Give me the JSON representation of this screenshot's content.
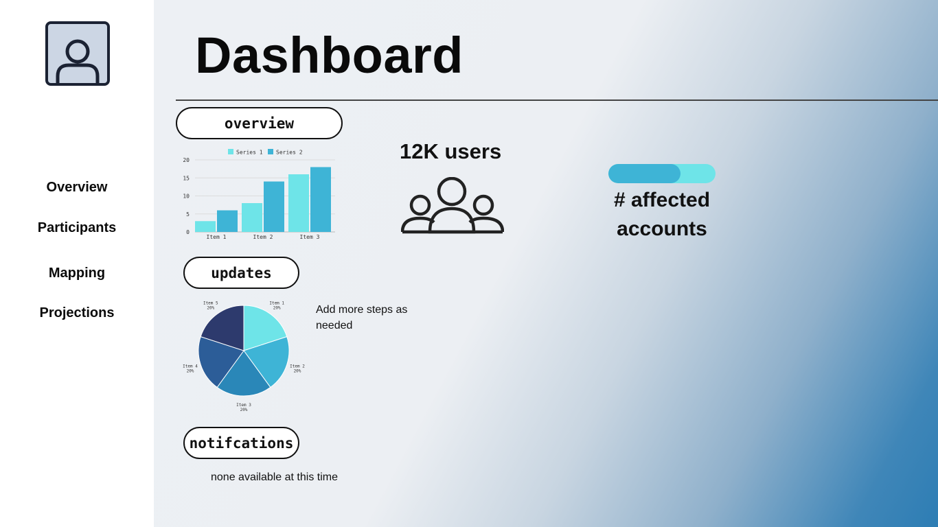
{
  "page": {
    "title": "Dashboard"
  },
  "sidebar": {
    "avatar_icon": "user-icon",
    "items": [
      {
        "label": "Overview"
      },
      {
        "label": "Participants"
      },
      {
        "label": "Mapping"
      },
      {
        "label": "Projections"
      }
    ]
  },
  "sections": {
    "overview": "overview",
    "updates": "updates",
    "notifications": "notifcations"
  },
  "stats": {
    "users": "12K users",
    "users_icon": "group-icon",
    "affected_label": "# affected accounts",
    "affected_progress": 0.67
  },
  "updates_note": "Add more steps as needed",
  "notifications_text": "none available at this time",
  "colors": {
    "series1": "#6ee4e8",
    "series2": "#3eb4d6",
    "pie": [
      "#6ee4e8",
      "#3eb4d6",
      "#2a87b8",
      "#2c5d98",
      "#2d3a6d"
    ]
  },
  "chart_data": [
    {
      "type": "bar",
      "categories": [
        "Item 1",
        "Item 2",
        "Item 3"
      ],
      "series": [
        {
          "name": "Series 1",
          "values": [
            3,
            8,
            16
          ]
        },
        {
          "name": "Series 2",
          "values": [
            6,
            14,
            18
          ]
        }
      ],
      "ylim": [
        0,
        20
      ],
      "yticks": [
        0,
        5,
        10,
        15,
        20
      ],
      "grid": true,
      "legend": "top"
    },
    {
      "type": "pie",
      "categories": [
        "Item 1",
        "Item 2",
        "Item 3",
        "Item 4",
        "Item 5"
      ],
      "values": [
        20,
        20,
        20,
        20,
        20
      ],
      "labels": [
        "20%",
        "20%",
        "20%",
        "20%",
        "20%"
      ]
    }
  ]
}
